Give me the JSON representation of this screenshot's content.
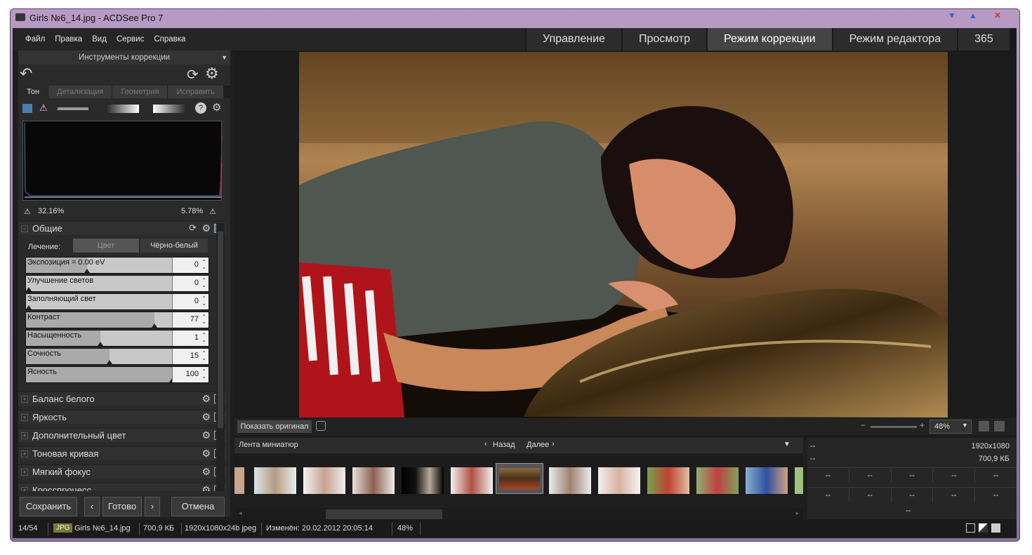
{
  "window": {
    "title": "Girls №6_14.jpg - ACDSee Pro 7"
  },
  "menu": [
    "Файл",
    "Правка",
    "Вид",
    "Сервис",
    "Справка"
  ],
  "mode_tabs": [
    "Управление",
    "Просмотр",
    "Режим коррекции",
    "Режим редактора",
    "365"
  ],
  "panel": {
    "title": "Инструменты коррекции",
    "subtabs": [
      "Тон",
      "Детализация",
      "Геометрия",
      "Исправить"
    ],
    "hist_left": "32.16%",
    "hist_right": "5.78%",
    "general_section": "Общие",
    "treatment_label": "Лечение:",
    "treatment_options": [
      "Цвет",
      "Чёрно-белый"
    ],
    "sliders": [
      {
        "label": "Экспозиция = 0.00 eV",
        "value": "0",
        "level": 0.42
      },
      {
        "label": "Улучшение светов",
        "value": "0",
        "level": 0.0
      },
      {
        "label": "Заполняющий свет",
        "value": "0",
        "level": 0.0
      },
      {
        "label": "Контраст",
        "value": "77",
        "level": 0.88
      },
      {
        "label": "Насыщенность",
        "value": "1",
        "level": 0.51
      },
      {
        "label": "Сочность",
        "value": "15",
        "level": 0.57
      },
      {
        "label": "Ясность",
        "value": "100",
        "level": 1.0
      }
    ],
    "sections": [
      "Баланс белого",
      "Яркость",
      "Дополнительный цвет",
      "Тоновая кривая",
      "Мягкий фокус",
      "Кросспроцесс"
    ],
    "buttons": {
      "save": "Сохранить",
      "done": "Готово",
      "cancel": "Отмена"
    }
  },
  "viewer": {
    "show_original": "Показать оригинал",
    "zoom": "48%"
  },
  "filmstrip": {
    "title": "Лента миниатюр",
    "back": "Назад",
    "next": "Далее"
  },
  "info": {
    "dims": "1920x1080",
    "size": "700,9 КБ",
    "dash": "--"
  },
  "status": {
    "index": "14/54",
    "type": "JPG",
    "filename": "Girls №6_14.jpg",
    "filesize": "700,9 КБ",
    "format": "1920x1080x24b jpeg",
    "modified": "Изменён: 20.02.2012 20:05:14",
    "zoom": "48%"
  }
}
